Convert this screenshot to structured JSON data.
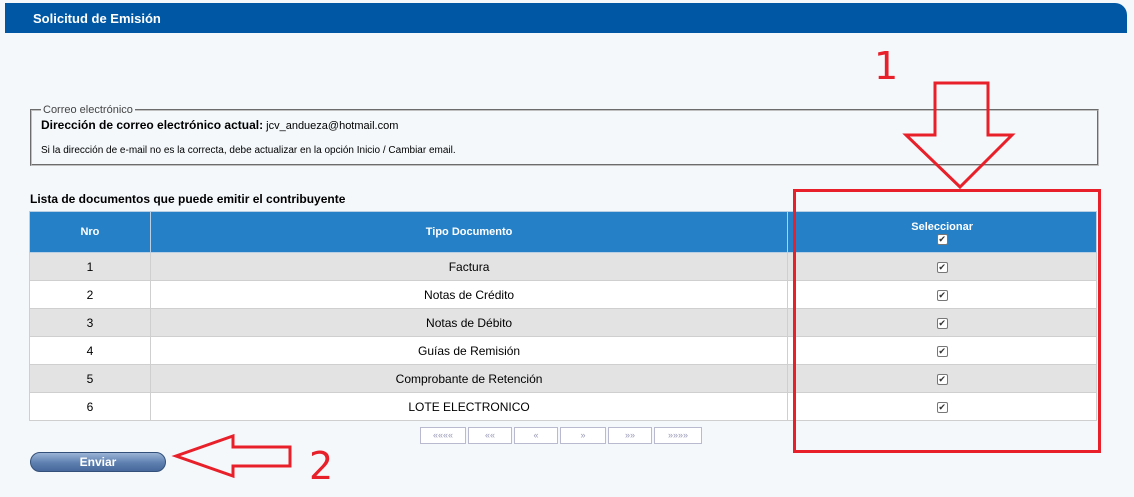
{
  "header": {
    "title": "Solicitud de Emisión"
  },
  "email_section": {
    "legend": "Correo electrónico",
    "label": "Dirección de correo electrónico actual:",
    "value": "jcv_andueza@hotmail.com",
    "note": "Si la dirección de e-mail no es la correcta, debe actualizar en la opción Inicio / Cambiar email."
  },
  "documents": {
    "title": "Lista de documentos que puede emitir el contribuyente",
    "columns": {
      "nro": "Nro",
      "tipo": "Tipo Documento",
      "seleccionar": "Seleccionar"
    },
    "select_all_checked": true,
    "rows": [
      {
        "nro": "1",
        "tipo": "Factura",
        "checked": true
      },
      {
        "nro": "2",
        "tipo": "Notas de Crédito",
        "checked": true
      },
      {
        "nro": "3",
        "tipo": "Notas de Débito",
        "checked": true
      },
      {
        "nro": "4",
        "tipo": "Guías de Remisión",
        "checked": true
      },
      {
        "nro": "5",
        "tipo": "Comprobante de Retención",
        "checked": true
      },
      {
        "nro": "6",
        "tipo": "LOTE ELECTRONICO",
        "checked": true
      }
    ]
  },
  "pager": {
    "first": "««««",
    "prev_page": "««",
    "prev": "«",
    "next": "»",
    "next_page": "»»",
    "last": "»»»»"
  },
  "actions": {
    "submit_label": "Enviar"
  },
  "annotations": {
    "marker_1": "1",
    "marker_2": "2",
    "color": "#e8202a"
  },
  "theme": {
    "header_bg": "#0058a4",
    "table_header_bg": "#2680c7",
    "row_alt_bg": "#e3e3e3"
  }
}
